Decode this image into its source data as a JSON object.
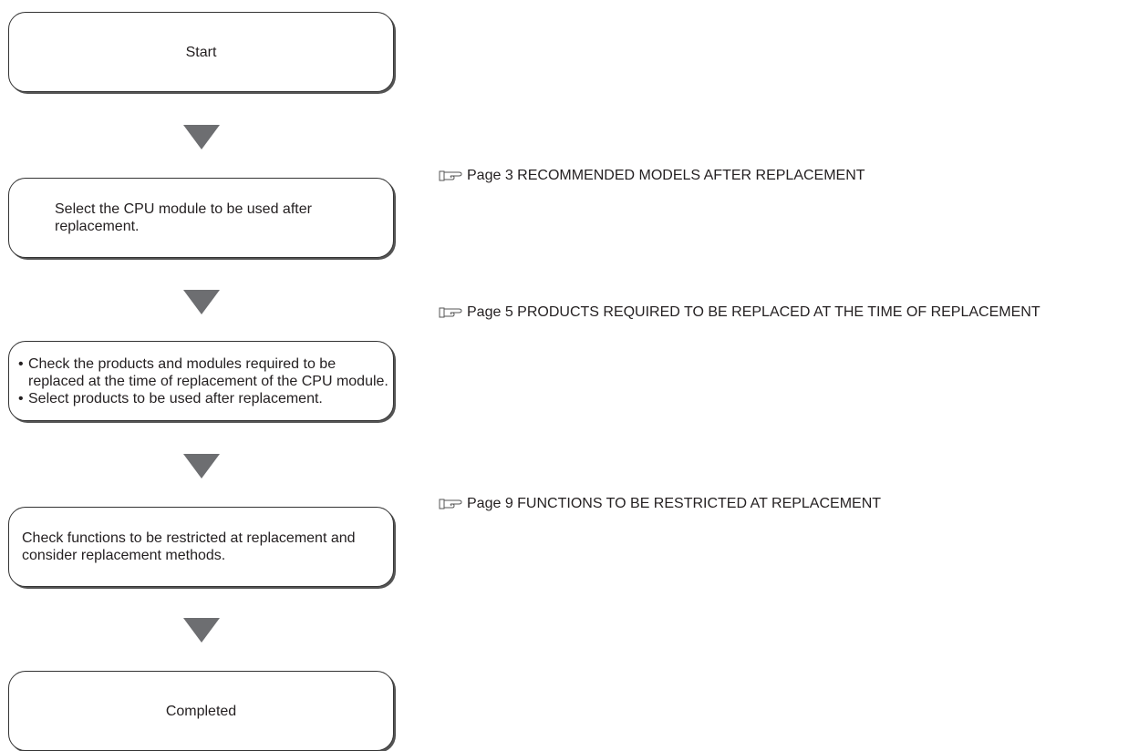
{
  "steps": {
    "start": "Start",
    "select_cpu": "Select the CPU module to be used after replacement.",
    "check_products": {
      "bullets": [
        "Check the products and modules required to be replaced at the time of replacement of the CPU module.",
        "Select products to be used after replacement."
      ]
    },
    "check_functions": "Check functions to be restricted at replacement and consider replacement methods.",
    "completed": "Completed"
  },
  "references": {
    "icon": "pointing-hand-icon",
    "page3": "Page 3 RECOMMENDED MODELS AFTER REPLACEMENT",
    "page5": "Page 5 PRODUCTS REQUIRED TO BE REPLACED AT THE TIME OF REPLACEMENT",
    "page9": "Page 9 FUNCTIONS TO BE RESTRICTED AT REPLACEMENT"
  },
  "colors": {
    "arrow": "#6d6e71",
    "box_border": "#333333",
    "text": "#231f20"
  }
}
